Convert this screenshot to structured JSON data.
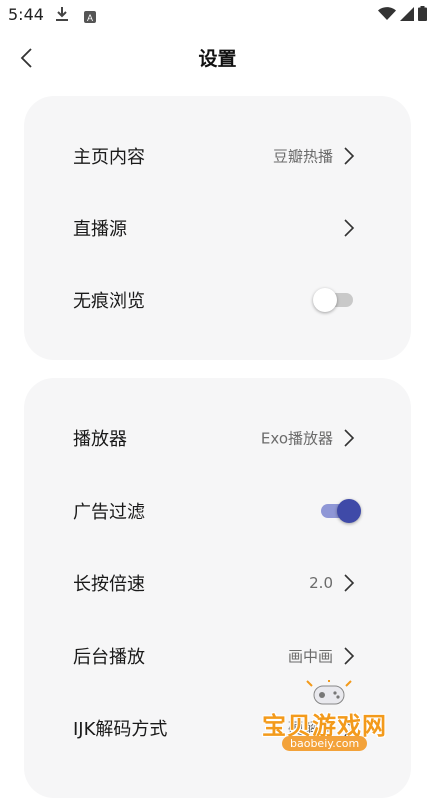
{
  "status_bar": {
    "time": "5:44",
    "a_label": "A"
  },
  "header": {
    "title": "设置"
  },
  "sections": [
    {
      "rows": [
        {
          "label": "主页内容",
          "value": "豆瓣热播"
        },
        {
          "label": "直播源",
          "value": ""
        },
        {
          "label": "无痕浏览",
          "toggle": false
        }
      ]
    },
    {
      "rows": [
        {
          "label": "播放器",
          "value": "Exo播放器"
        },
        {
          "label": "广告过滤",
          "toggle": true
        },
        {
          "label": "长按倍速",
          "value": "2.0"
        },
        {
          "label": "后台播放",
          "value": "画中画"
        },
        {
          "label": "IJK解码方式",
          "value": "硬解码"
        }
      ]
    }
  ],
  "watermark": {
    "title": "宝贝游戏网",
    "url": "baobeiy.com"
  },
  "colors": {
    "toggle_on": "#3f4aa8",
    "card_bg": "#f6f6f7"
  }
}
